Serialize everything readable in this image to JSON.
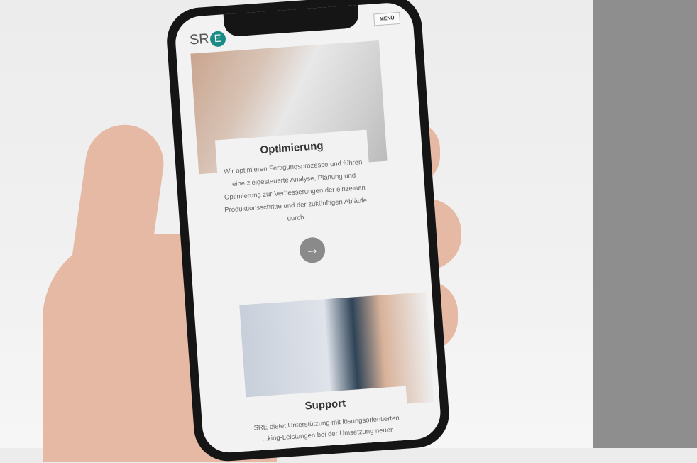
{
  "header": {
    "logo_text": "SR",
    "logo_letter": "E",
    "menu_label": "MENÜ"
  },
  "sections": [
    {
      "title": "Optimierung",
      "text": "Wir optimieren Fertigungsprozesse und führen eine zielgesteuerte Analyse, Planung und Optimierung zur Verbesserungen der einzelnen Produktionsschritte und der zukünftigen Abläufe durch.",
      "button_icon": "arrow-right-icon",
      "button_glyph": "→"
    },
    {
      "title": "Support",
      "text": "SRE bietet Unterstützung mit lösungsorientierten ...king-Leistungen bei der Umsetzung neuer"
    }
  ]
}
